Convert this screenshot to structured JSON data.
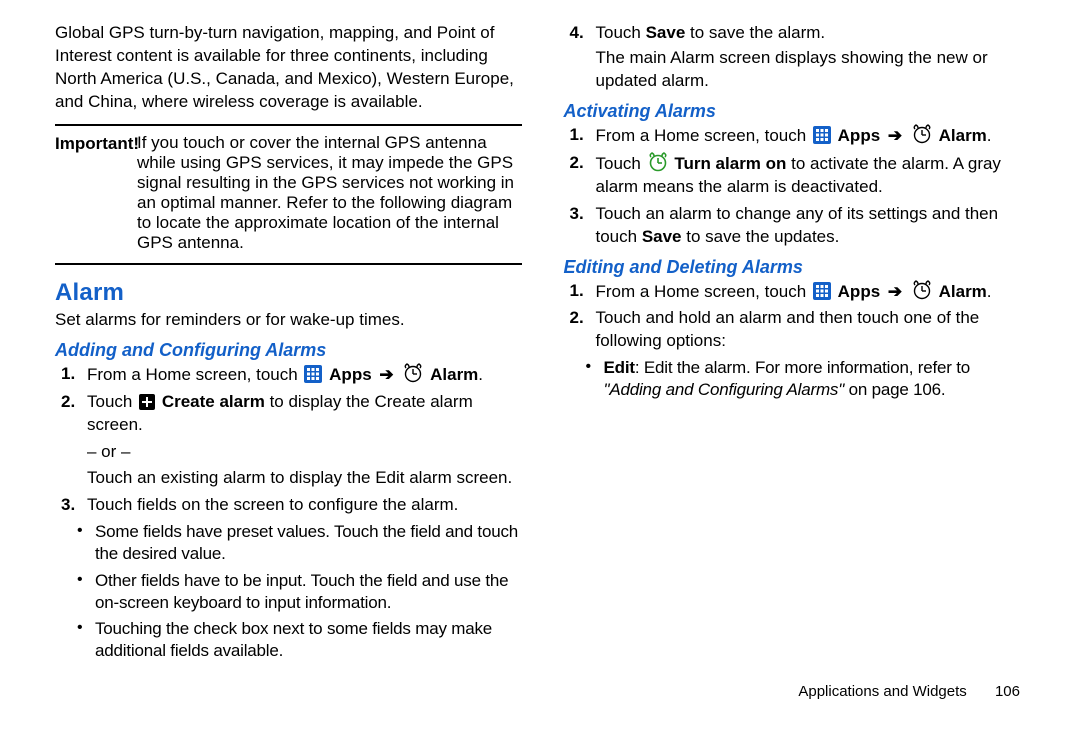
{
  "intro_para": "Global GPS turn-by-turn navigation, mapping, and Point of Interest content is available for three continents, including North America (U.S., Canada, and Mexico), Western Europe, and China, where wireless coverage is available.",
  "important_label": "Important!",
  "important_body": "If you touch or cover the internal GPS antenna while using GPS services, it may impede the GPS signal resulting in the GPS services not working in an optimal manner. Refer to the following diagram to locate the approximate location of the internal GPS antenna.",
  "h1_alarm": "Alarm",
  "alarm_intro": "Set alarms for reminders or for wake-up times.",
  "h2_add": "Adding and Configuring Alarms",
  "add_s1_a": "From a Home screen, touch ",
  "apps_label": " Apps",
  "arrow": "➔",
  "alarm_label": " Alarm",
  "period": ".",
  "add_s2_a": "Touch ",
  "create_alarm_label": " Create alarm",
  "add_s2_b": " to display the Create alarm screen.",
  "or_text": "– or –",
  "add_s2_c": "Touch an existing alarm to display the Edit alarm screen.",
  "add_s3": "Touch fields on the screen to configure the alarm.",
  "bul1": "Some fields have preset values. Touch the field and touch the desired value.",
  "bul2": "Other fields have to be input. Touch the field and use the on-screen keyboard to input information.",
  "bul3": "Touching the check box next to some fields may make additional fields available.",
  "add_s4_a": "Touch ",
  "save_label": "Save",
  "add_s4_b": " to save the alarm.",
  "add_after4": "The main Alarm screen displays showing the new or updated alarm.",
  "h2_act": "Activating Alarms",
  "act_s2_a": "Touch ",
  "turn_on_label": " Turn alarm on",
  "act_s2_b": " to activate the alarm. A gray alarm means the alarm is deactivated.",
  "act_s3_a": "Touch an alarm to change any of its settings and then touch ",
  "act_s3_b": " to save the updates.",
  "h2_edit": "Editing and Deleting Alarms",
  "edit_s2": "Touch and hold an alarm and then touch one of the following options:",
  "edit_bul_label": "Edit",
  "edit_bul_a": ": Edit the alarm. For more information, refer to ",
  "edit_bul_ref": "\"Adding and Configuring Alarms\"",
  "edit_bul_b": " on page 106.",
  "footer_section": "Applications and Widgets",
  "footer_page": "106",
  "n1": "1.",
  "n2": "2.",
  "n3": "3.",
  "n4": "4."
}
